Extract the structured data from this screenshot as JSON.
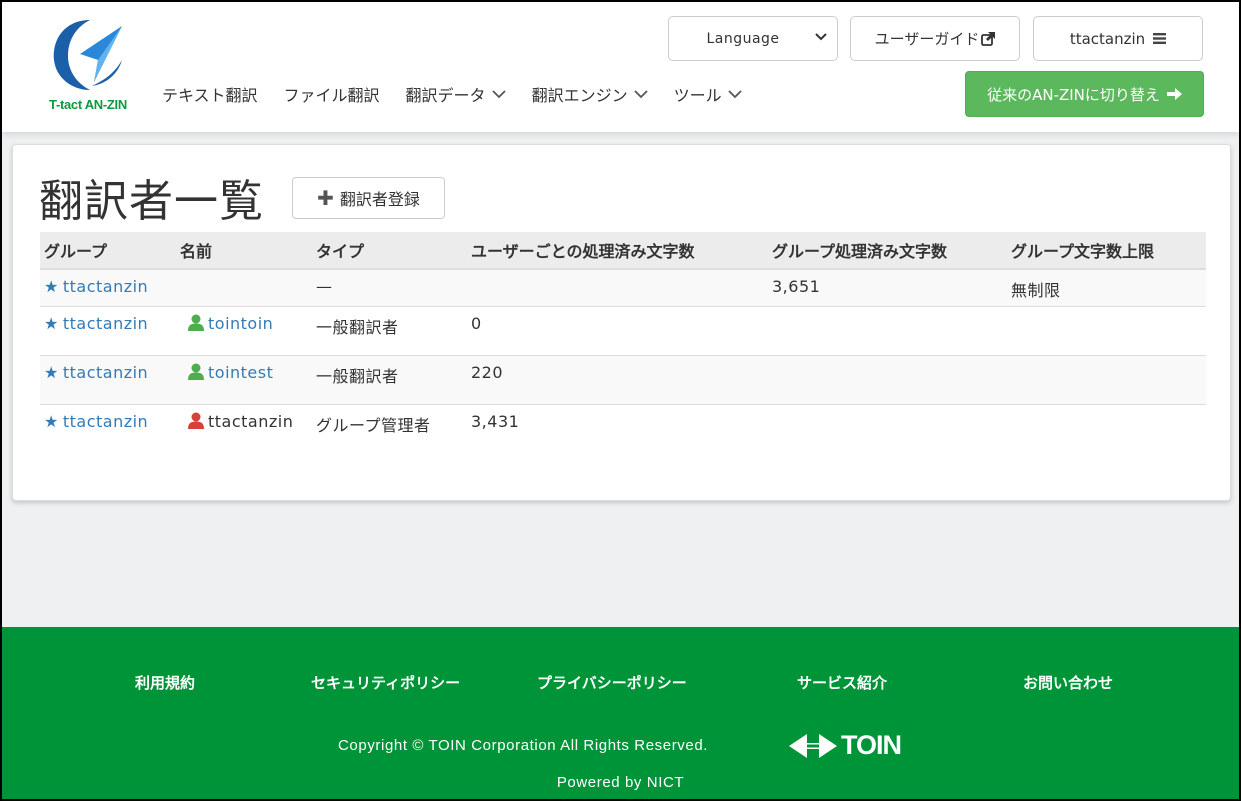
{
  "header": {
    "logo_text": "T-tact AN-ZIN",
    "nav": [
      {
        "label": "テキスト翻訳"
      },
      {
        "label": "ファイル翻訳"
      },
      {
        "label": "翻訳データ"
      },
      {
        "label": "翻訳エンジン"
      },
      {
        "label": "ツール"
      }
    ],
    "language_select": "Language",
    "guide_label": "ユーザーガイド",
    "user_label": "ttactanzin",
    "switch_label": "従来のAN-ZINに切り替え",
    "colors": {
      "brand_green": "#0b9a3e",
      "switch_button": "#5cb85c"
    }
  },
  "main": {
    "title": "翻訳者一覧",
    "add_button": "翻訳者登録",
    "table": {
      "headers": [
        "グループ",
        "名前",
        "タイプ",
        "ユーザーごとの処理済み文字数",
        "グループ処理済み文字数",
        "グループ文字数上限"
      ],
      "rows": [
        {
          "group": "ttactanzin",
          "name": "",
          "type": "—",
          "user_chars": "",
          "group_chars": "3,651",
          "group_limit": "無制限"
        },
        {
          "group": "ttactanzin",
          "name": "tointoin",
          "type": "一般翻訳者",
          "user_chars": "0",
          "group_chars": "",
          "group_limit": "",
          "user_icon": "person-green-icon"
        },
        {
          "group": "ttactanzin",
          "name": "tointest",
          "type": "一般翻訳者",
          "user_chars": "220",
          "group_chars": "",
          "group_limit": "",
          "user_icon": "person-green-icon"
        },
        {
          "group": "ttactanzin",
          "name": "ttactanzin",
          "type": "グループ管理者",
          "user_chars": "3,431",
          "group_chars": "",
          "group_limit": "",
          "user_icon": "person-red-icon"
        }
      ]
    }
  },
  "footer": {
    "links": [
      "利用規約",
      "セキュリティポリシー",
      "プライバシーポリシー",
      "サービス紹介",
      "お問い合わせ"
    ],
    "copyright": "Copyright © TOIN Corporation All Rights Reserved.",
    "toin_logo": "TOIN",
    "powered": "Powered by NICT",
    "colors": {
      "background": "#009439"
    }
  }
}
